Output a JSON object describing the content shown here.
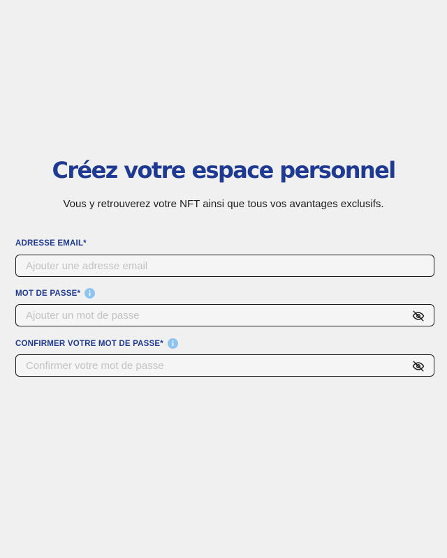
{
  "header": {
    "title": "Créez votre espace personnel",
    "subtitle": "Vous y retrouverez votre NFT ainsi que tous vos avantages exclusifs."
  },
  "form": {
    "email": {
      "label": "ADRESSE EMAIL*",
      "placeholder": "Ajouter une adresse email",
      "value": ""
    },
    "password": {
      "label": "MOT DE PASSE*",
      "placeholder": "Ajouter un mot de passe",
      "value": "",
      "info_icon": "info-icon",
      "toggle_icon": "eye-off-icon"
    },
    "confirm_password": {
      "label": "CONFIRMER VOTRE MOT DE PASSE*",
      "placeholder": "Confirmer votre mot de passe",
      "value": "",
      "info_icon": "info-icon",
      "toggle_icon": "eye-off-icon"
    }
  },
  "colors": {
    "background": "#f0f0f0",
    "brand_blue": "#1f3a93",
    "info_blue": "#8ec4f2",
    "placeholder": "#c2c2c2",
    "border": "#1b1b1b"
  }
}
